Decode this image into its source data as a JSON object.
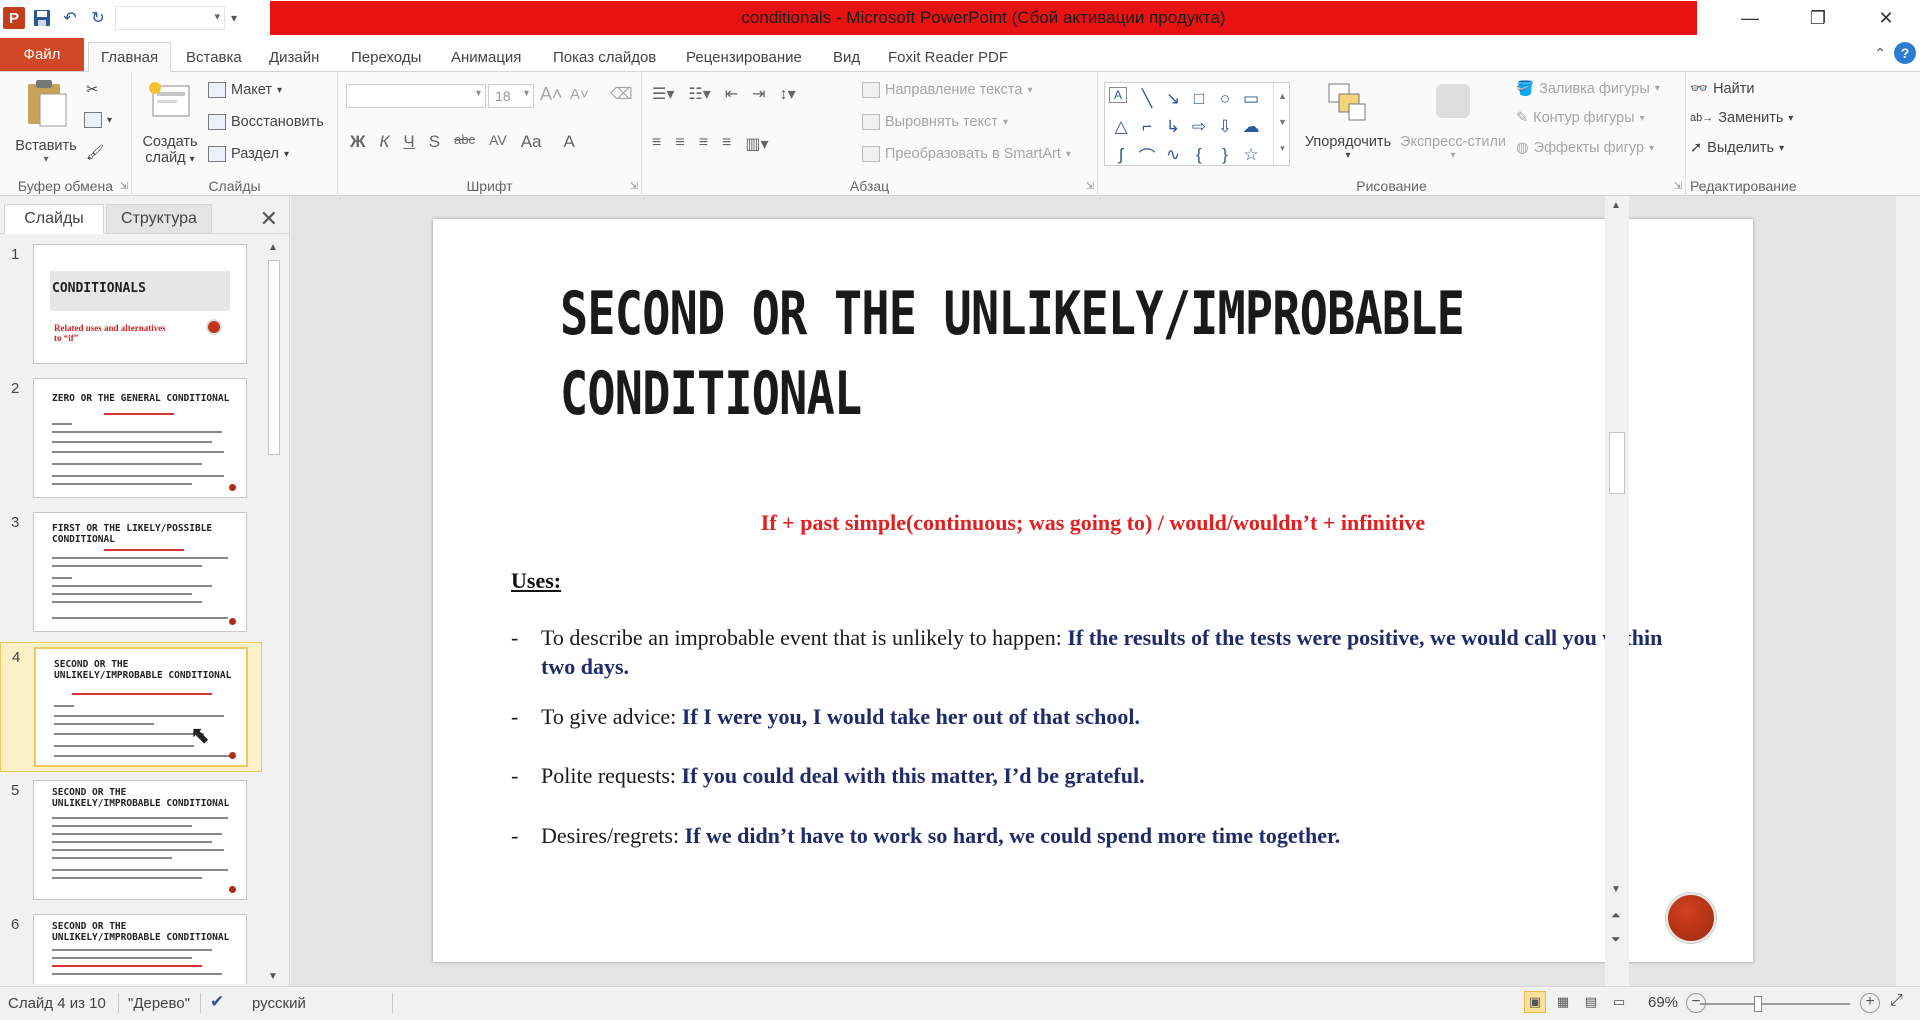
{
  "window": {
    "title": "conditionals - Microsoft PowerPoint (Сбой активации продукта)"
  },
  "ribbon_tabs": {
    "file": "Файл",
    "items": [
      "Главная",
      "Вставка",
      "Дизайн",
      "Переходы",
      "Анимация",
      "Показ слайдов",
      "Рецензирование",
      "Вид",
      "Foxit Reader PDF"
    ]
  },
  "ribbon": {
    "clipboard": {
      "label": "Буфер обмена",
      "paste": "Вставить"
    },
    "slides": {
      "label": "Слайды",
      "new_slide_line1": "Создать",
      "new_slide_line2": "слайд",
      "layout": "Макет",
      "reset": "Восстановить",
      "section": "Раздел"
    },
    "font": {
      "label": "Шрифт",
      "font_name": "",
      "font_size": "18"
    },
    "paragraph": {
      "label": "Абзац",
      "text_direction": "Направление текста",
      "align_text": "Выровнять текст",
      "smartart": "Преобразовать в SmartArt"
    },
    "drawing": {
      "label": "Рисование",
      "arrange": "Упорядочить",
      "quick_styles": "Экспресс-стили",
      "shape_fill": "Заливка фигуры",
      "shape_outline": "Контур фигуры",
      "shape_effects": "Эффекты фигур"
    },
    "editing": {
      "label": "Редактирование",
      "find": "Найти",
      "replace": "Заменить",
      "select": "Выделить"
    }
  },
  "left_pane": {
    "tab_slides": "Слайды",
    "tab_outline": "Структура",
    "thumbnails": [
      {
        "num": "1",
        "title": "CONDITIONALS",
        "subtitle": "Related uses and alternatives to “if”"
      },
      {
        "num": "2",
        "title": "ZERO OR THE GENERAL CONDITIONAL"
      },
      {
        "num": "3",
        "title": "FIRST OR THE LIKELY/POSSIBLE CONDITIONAL"
      },
      {
        "num": "4",
        "title": "SECOND OR THE UNLIKELY/IMPROBABLE CONDITIONAL"
      },
      {
        "num": "5",
        "title": "SECOND OR THE UNLIKELY/IMPROBABLE CONDITIONAL"
      },
      {
        "num": "6",
        "title": "SECOND OR THE UNLIKELY/IMPROBABLE CONDITIONAL"
      }
    ]
  },
  "slide": {
    "title": "SECOND OR THE UNLIKELY/IMPROBABLE CONDITIONAL",
    "formula": "If + past simple(continuous; was going to) / would/wouldn’t + infinitive",
    "uses_heading": "Uses:",
    "bullets": [
      {
        "dash": "-",
        "plain": "To describe an improbable event that is unlikely to happen: ",
        "bold": "If the results of the tests were positive, we would call you within two days."
      },
      {
        "dash": "-",
        "plain": "To give advice: ",
        "bold": "If I were you, I would take her out of that school."
      },
      {
        "dash": "-",
        "plain": "Polite requests: ",
        "bold": "If you could deal with this matter, I’d be grateful."
      },
      {
        "dash": "-",
        "plain": "Desires/regrets: ",
        "bold": "If we didn’t have to work so hard, we could spend more time together."
      }
    ]
  },
  "status": {
    "slide_of": "Слайд 4 из 10",
    "theme": "\"Дерево\"",
    "language": "русский",
    "zoom": "69%"
  }
}
